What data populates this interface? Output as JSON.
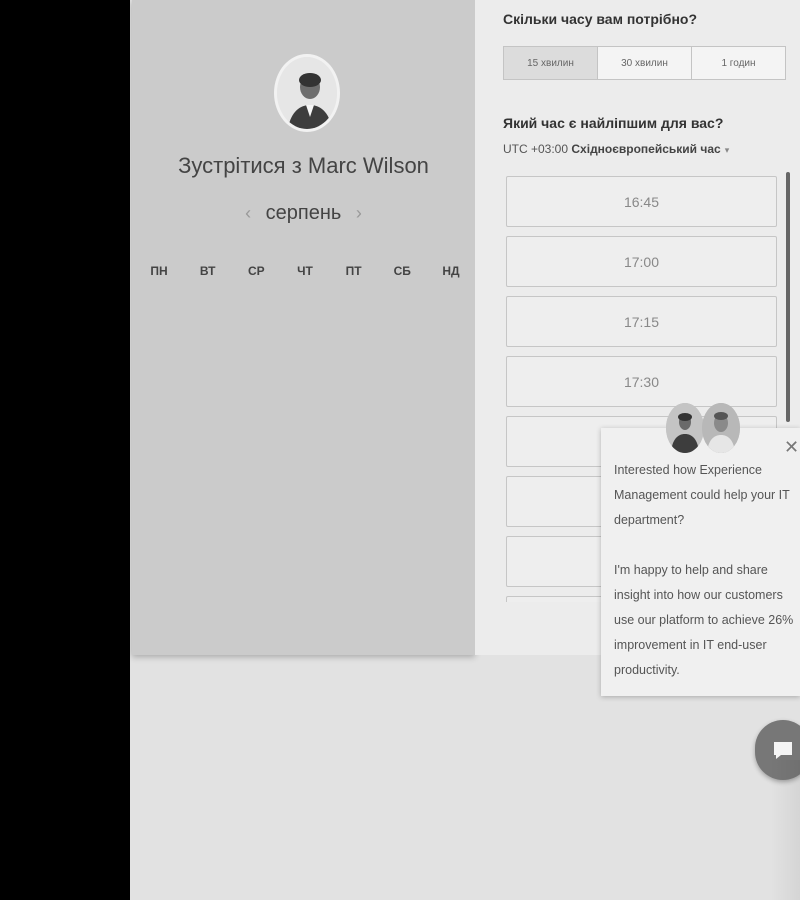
{
  "host": {
    "meet_label": "Зустрітися з Marc Wilson"
  },
  "calendar": {
    "prev_arrow": "‹",
    "month": "серпень",
    "next_arrow": "›",
    "weekdays": [
      "ПН",
      "ВТ",
      "СР",
      "ЧТ",
      "ПТ",
      "СБ",
      "НД"
    ]
  },
  "duration": {
    "question": "Скільки часу вам потрібно?",
    "options": [
      "15 хвилин",
      "30 хвилин",
      "1 годин"
    ],
    "selected": "15 хвилин"
  },
  "time": {
    "question": "Який час є найліпшим для вас?",
    "timezone_offset": "UTC +03:00",
    "timezone_name": "Східноєвропейський час",
    "caret": "▾",
    "slots": [
      "16:45",
      "17:00",
      "17:15",
      "17:30",
      "",
      "",
      ""
    ]
  },
  "chat_popup": {
    "close": "✕",
    "message_1": "Interested how Experience Management could help your IT department?",
    "message_2": "I'm happy to help and share insight into how our customers use our platform to achieve 26% improvement in IT end-user productivity."
  },
  "icons": {
    "close": "close-icon",
    "chat": "chat-bubble-icon",
    "avatar": "person-avatar-icon"
  },
  "colors": {
    "page_bg": "#e2e2e2",
    "left_panel": "#cbcbcb",
    "right_panel": "#ececec",
    "chat_button": "#777777"
  }
}
